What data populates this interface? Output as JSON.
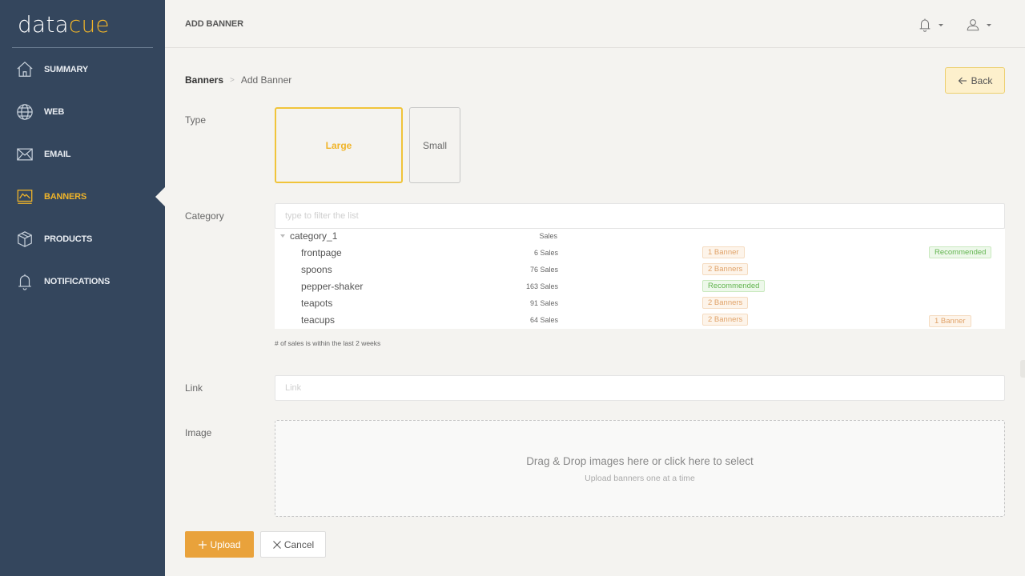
{
  "brand": {
    "part1": "data",
    "part2": "cue"
  },
  "colors": {
    "sidebar": "#34465d",
    "accent": "#f0b429",
    "upload": "#e9a23b",
    "tag_orange": "#e0a36a",
    "tag_green": "#62b44f"
  },
  "sidebar": {
    "items": [
      {
        "label": "SUMMARY",
        "icon": "home-icon",
        "active": false
      },
      {
        "label": "WEB",
        "icon": "globe-icon",
        "active": false
      },
      {
        "label": "EMAIL",
        "icon": "envelope-icon",
        "active": false
      },
      {
        "label": "BANNERS",
        "icon": "image-icon",
        "active": true
      },
      {
        "label": "PRODUCTS",
        "icon": "box-icon",
        "active": false
      },
      {
        "label": "NOTIFICATIONS",
        "icon": "bell-icon",
        "active": false
      }
    ]
  },
  "header": {
    "title": "ADD BANNER",
    "icons": [
      "bell-icon",
      "user-icon"
    ]
  },
  "breadcrumb": {
    "root": "Banners",
    "separator": ">",
    "current": "Add Banner"
  },
  "back_button": {
    "label": "Back",
    "icon": "arrow-left-icon"
  },
  "form": {
    "type": {
      "label": "Type",
      "options": [
        {
          "label": "Large",
          "selected": true
        },
        {
          "label": "Small",
          "selected": false
        }
      ]
    },
    "category": {
      "label": "Category",
      "filter_placeholder": "type to filter the list",
      "group": {
        "name": "category_1",
        "sales_header": "Sales"
      },
      "items": [
        {
          "name": "frontpage",
          "sales": "6 Sales",
          "large_tag": {
            "text": "1 Banner",
            "kind": "orange"
          },
          "small_tag": {
            "text": "Recommended",
            "kind": "green"
          }
        },
        {
          "name": "spoons",
          "sales": "76 Sales",
          "large_tag": {
            "text": "2 Banners",
            "kind": "orange"
          },
          "small_tag": null
        },
        {
          "name": "pepper-shaker",
          "sales": "163 Sales",
          "large_tag": {
            "text": "Recommended",
            "kind": "green"
          },
          "small_tag": null
        },
        {
          "name": "teapots",
          "sales": "91 Sales",
          "large_tag": {
            "text": "2 Banners",
            "kind": "orange"
          },
          "small_tag": null
        },
        {
          "name": "teacups",
          "sales": "64 Sales",
          "large_tag": {
            "text": "2 Banners",
            "kind": "orange"
          },
          "small_tag": {
            "text": "1 Banner",
            "kind": "orange"
          }
        }
      ],
      "note": "# of sales is within the last 2 weeks"
    },
    "link": {
      "label": "Link",
      "placeholder": "Link",
      "value": ""
    },
    "image": {
      "label": "Image",
      "dropzone_main": "Drag & Drop images here or click here to select",
      "dropzone_sub": "Upload banners one at a time"
    }
  },
  "actions": {
    "upload": {
      "label": "Upload",
      "icon": "plus-icon"
    },
    "cancel": {
      "label": "Cancel",
      "icon": "close-icon"
    }
  }
}
